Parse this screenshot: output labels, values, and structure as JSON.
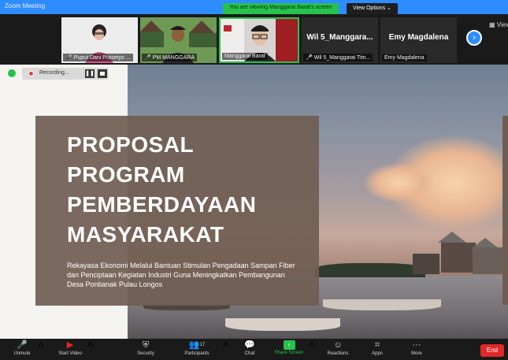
{
  "window": {
    "title": "Zoom Meeting"
  },
  "banner": {
    "viewing_text": "You are viewing Manggarai Barat's screen",
    "view_options": "View Options ⌄"
  },
  "gallery": {
    "tiles": [
      {
        "name": "Puput Dani Prasetyo ...",
        "muted": true
      },
      {
        "name": "PM MANGGARA",
        "muted": true
      },
      {
        "name": "Manggarai Barat",
        "muted": false
      },
      {
        "display_name": "Wil 5_Manggara...",
        "name": "Wil 5_Manggarai Tim...",
        "muted": true
      },
      {
        "display_name": "Emy Magdalena",
        "name": "Emy Magdalena",
        "muted": false
      }
    ],
    "view_label": "View"
  },
  "recording": {
    "label": "Recording..."
  },
  "slide": {
    "heading": "PROPOSAL PROGRAM PEMBERDAYAAN MASYARAKAT",
    "subtitle": "Rekayasa Ekonomi Melalui Bantuan Stimulan Pengadaan Sampan Fiber dan Penciptaan Kegiatan Industri Guna Meningkatkan Pembangunan Desa Pontianak Pulau Longos"
  },
  "toolbar": {
    "unmute": "Unmute",
    "start_video": "Start Video",
    "security": "Security",
    "participants": "Participants",
    "participants_count": "17",
    "chat": "Chat",
    "share_screen": "Share Screen",
    "reactions": "Reactions",
    "apps": "Apps",
    "more": "More",
    "end": "End"
  },
  "colors": {
    "accent": "#2d8cff",
    "share": "#27c24c",
    "end": "#e02828",
    "panel": "#705d52"
  },
  "icons": [
    "mic-muted-icon",
    "video-off-icon",
    "shield-icon",
    "people-icon",
    "chat-icon",
    "share-arrow-icon",
    "reactions-icon",
    "apps-icon",
    "more-icon",
    "chevron-right-icon"
  ]
}
